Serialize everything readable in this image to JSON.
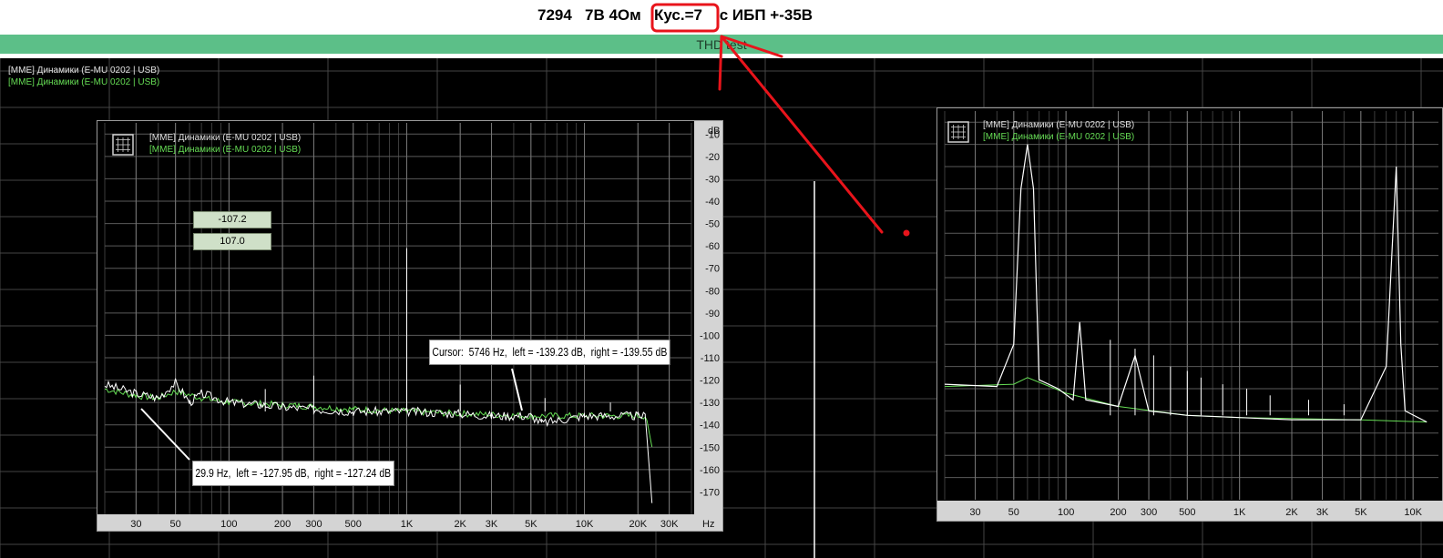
{
  "heading": {
    "part1": "7294   7В 4Ом ",
    "highlight": "Кус.=7",
    "part2": " с ИБП +-35В"
  },
  "window_title": "THD test",
  "main_legend": [
    "[MME] Динамики (E-MU 0202 | USB)",
    "[MME] Динамики (E-MU 0202 | USB)"
  ],
  "left_panel": {
    "legend": [
      "[MME] Динамики (E-MU 0202 | USB)",
      "[MME] Динамики (E-MU 0202 | USB)"
    ],
    "value_box_1": "-107.2",
    "value_box_2": "107.0",
    "cursor_readout": "Cursor:  5746 Hz,  left = -139.23 dB,  right = -139.55 dB",
    "marker_readout": "29.9 Hz,  left = -127.95 dB,  right = -127.24 dB",
    "y_unit": "dB",
    "x_unit": "Hz",
    "y_ticks": [
      "-10",
      "-20",
      "-30",
      "-40",
      "-50",
      "-60",
      "-70",
      "-80",
      "-90",
      "-100",
      "-110",
      "-120",
      "-130",
      "-140",
      "-150",
      "-160",
      "-170"
    ],
    "x_ticks": [
      "30",
      "50",
      "100",
      "200",
      "300",
      "500",
      "1K",
      "2K",
      "3K",
      "5K",
      "10K",
      "20K",
      "30K"
    ]
  },
  "right_panel": {
    "legend": [
      "[MME] Динамики (E-MU 0202 | USB)",
      "[MME] Динамики (E-MU 0202 | USB)"
    ],
    "x_ticks": [
      "30",
      "50",
      "100",
      "200",
      "300",
      "500",
      "1K",
      "2K",
      "3K",
      "5K",
      "10K"
    ]
  },
  "colors": {
    "annotation": "#e8141b",
    "trace_left": "#ffffff",
    "trace_right": "#66dd55",
    "grid": "#5a5a5a",
    "titlebar": "#5cbf88"
  },
  "chart_data": [
    {
      "type": "line",
      "scale": "log-x",
      "x_ticks": [
        "30",
        "50",
        "100",
        "200",
        "300",
        "500",
        "1K",
        "2K",
        "3K",
        "5K",
        "10K",
        "20K",
        "30K"
      ],
      "y_ticks": [
        "-10",
        "-20",
        "-30",
        "-40",
        "-50",
        "-60",
        "-70",
        "-80",
        "-90",
        "-100",
        "-110",
        "-120",
        "-130",
        "-140",
        "-150",
        "-160",
        "-170"
      ],
      "ylim": [
        -180,
        -5
      ],
      "xlim": [
        20,
        40000
      ],
      "series": [
        {
          "points": [
            [
              20,
              -122
            ],
            [
              30,
              -126
            ],
            [
              40,
              -128
            ],
            [
              50,
              -121
            ],
            [
              60,
              -130
            ],
            [
              70,
              -126
            ],
            [
              100,
              -130
            ],
            [
              150,
              -131
            ],
            [
              200,
              -132
            ],
            [
              300,
              -133
            ],
            [
              500,
              -134
            ],
            [
              700,
              -134
            ],
            [
              1000,
              -134
            ],
            [
              1000,
              -61
            ],
            [
              1000,
              -134
            ],
            [
              2000,
              -135
            ],
            [
              3000,
              -136
            ],
            [
              5000,
              -136
            ],
            [
              5746,
              -139.23
            ],
            [
              10000,
              -136
            ],
            [
              20000,
              -136
            ],
            [
              22000,
              -136
            ],
            [
              24000,
              -175
            ]
          ]
        },
        {
          "points": [
            [
              20,
              -124
            ],
            [
              30,
              -127
            ],
            [
              40,
              -128
            ],
            [
              50,
              -125
            ],
            [
              70,
              -128
            ],
            [
              100,
              -130
            ],
            [
              200,
              -131
            ],
            [
              500,
              -133
            ],
            [
              1000,
              -134
            ],
            [
              2000,
              -135
            ],
            [
              5000,
              -136
            ],
            [
              10000,
              -136
            ],
            [
              22000,
              -136
            ],
            [
              24000,
              -150
            ]
          ]
        }
      ]
    },
    {
      "type": "line",
      "scale": "log-x",
      "x_ticks": [
        "30",
        "50",
        "100",
        "200",
        "300",
        "500",
        "1K",
        "2K",
        "3K",
        "5K",
        "10K"
      ],
      "ylim": [
        -180,
        -5
      ],
      "xlim": [
        20,
        14000
      ],
      "series": [
        {
          "points": [
            [
              20,
              -128
            ],
            [
              40,
              -129
            ],
            [
              50,
              -110
            ],
            [
              55,
              -40
            ],
            [
              60,
              -20
            ],
            [
              65,
              -40
            ],
            [
              70,
              -126
            ],
            [
              90,
              -130
            ],
            [
              110,
              -135
            ],
            [
              120,
              -100
            ],
            [
              130,
              -135
            ],
            [
              200,
              -138
            ],
            [
              250,
              -115
            ],
            [
              300,
              -140
            ],
            [
              500,
              -142
            ],
            [
              1000,
              -143
            ],
            [
              2000,
              -144
            ],
            [
              5000,
              -144
            ],
            [
              7000,
              -120
            ],
            [
              8000,
              -30
            ],
            [
              8500,
              -110
            ],
            [
              9000,
              -140
            ],
            [
              12000,
              -145
            ]
          ]
        },
        {
          "points": [
            [
              20,
              -129
            ],
            [
              50,
              -128
            ],
            [
              60,
              -125
            ],
            [
              100,
              -132
            ],
            [
              200,
              -138
            ],
            [
              500,
              -142
            ],
            [
              1000,
              -143
            ],
            [
              5000,
              -144
            ],
            [
              12000,
              -145
            ]
          ]
        }
      ]
    }
  ]
}
